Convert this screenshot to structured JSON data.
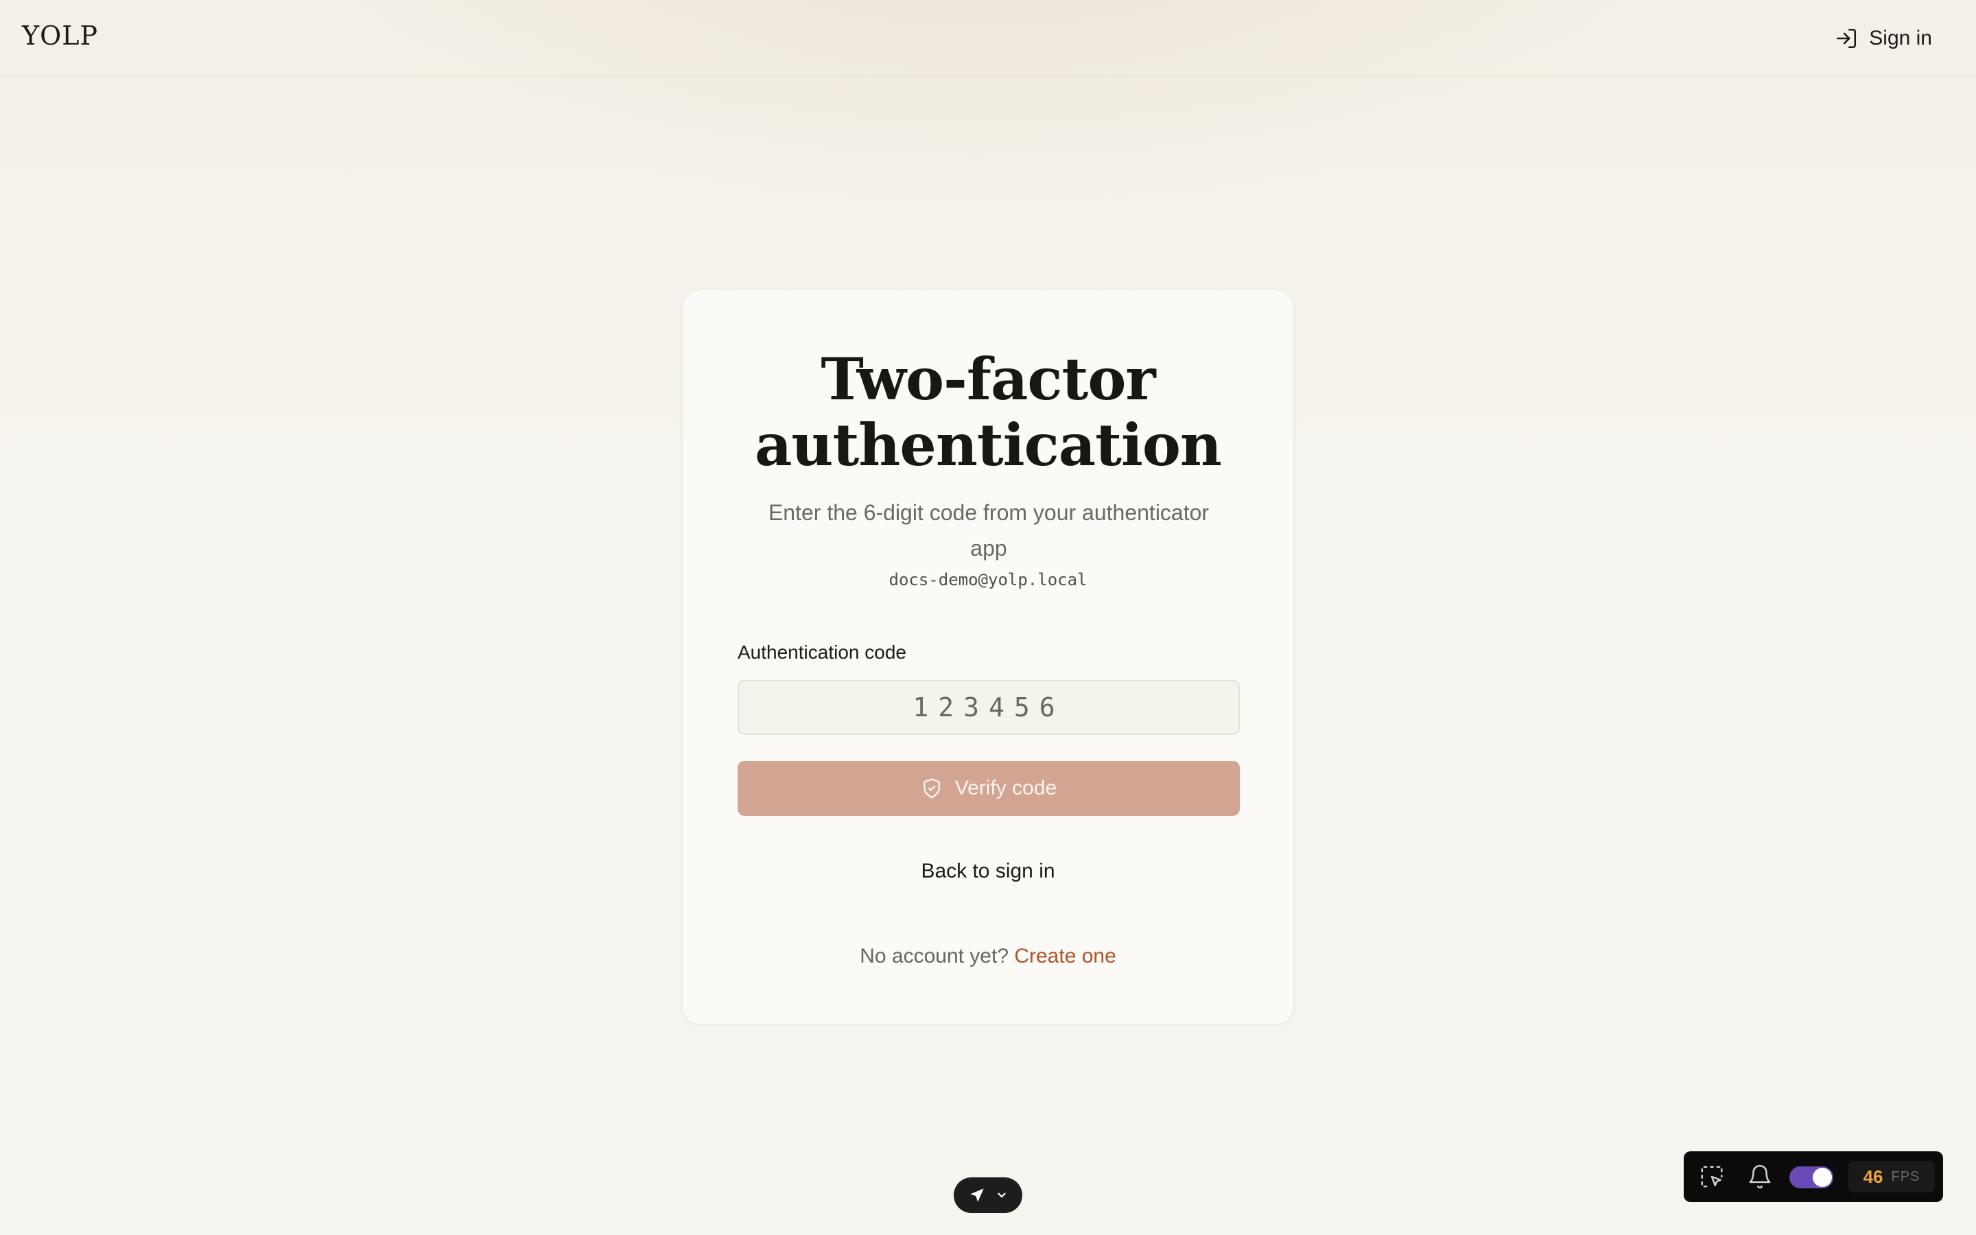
{
  "header": {
    "logo": "YOLP",
    "signin_label": "Sign in",
    "signin_icon": "log-in-icon"
  },
  "card": {
    "title": "Two-factor authentication",
    "subtitle": "Enter the 6-digit code from your authenticator app",
    "email": "docs-demo@yolp.local",
    "code_label": "Authentication code",
    "code_value": "",
    "code_placeholder": "123456",
    "verify_label": "Verify code",
    "verify_icon": "shield-check-icon",
    "back_label": "Back to sign in",
    "no_account_text": "No account yet?",
    "create_label": "Create one"
  },
  "nav_pill": {
    "icons": [
      "send-arrow-icon",
      "chevron-down-icon"
    ]
  },
  "devbar": {
    "icons": [
      "select-cursor-icon",
      "bell-icon"
    ],
    "toggle_on": true,
    "fps_value": "46",
    "fps_label": "FPS"
  },
  "colors": {
    "background": "#f6f4ee",
    "accent": "#b0532b",
    "button_disabled": "#d2a593",
    "toggle": "#6a4bb8",
    "fps": "#f0a33a"
  }
}
